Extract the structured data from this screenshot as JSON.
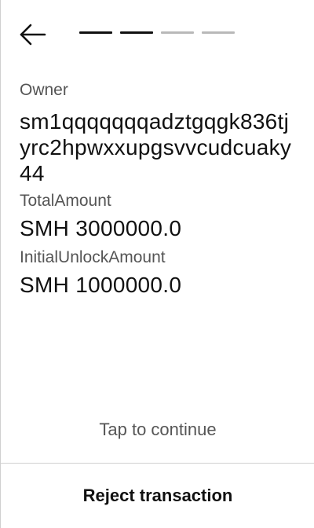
{
  "header": {
    "back_icon": "arrow-left-icon",
    "progress": {
      "total_steps": 4,
      "active_steps": 2
    }
  },
  "fields": [
    {
      "label": "Owner",
      "value": "sm1qqqqqqqadztgqgk836tjyrc2hpwxxupgsvvcudcuaky44"
    },
    {
      "label": "TotalAmount",
      "value": "SMH 3000000.0"
    },
    {
      "label": "InitialUnlockAmount",
      "value": "SMH 1000000.0"
    }
  ],
  "actions": {
    "tap_to_continue": "Tap to continue",
    "reject": "Reject transaction"
  },
  "colors": {
    "text_primary": "#111111",
    "text_secondary": "#555555",
    "progress_inactive": "#b9b9b9",
    "divider": "#d0d0d0"
  }
}
